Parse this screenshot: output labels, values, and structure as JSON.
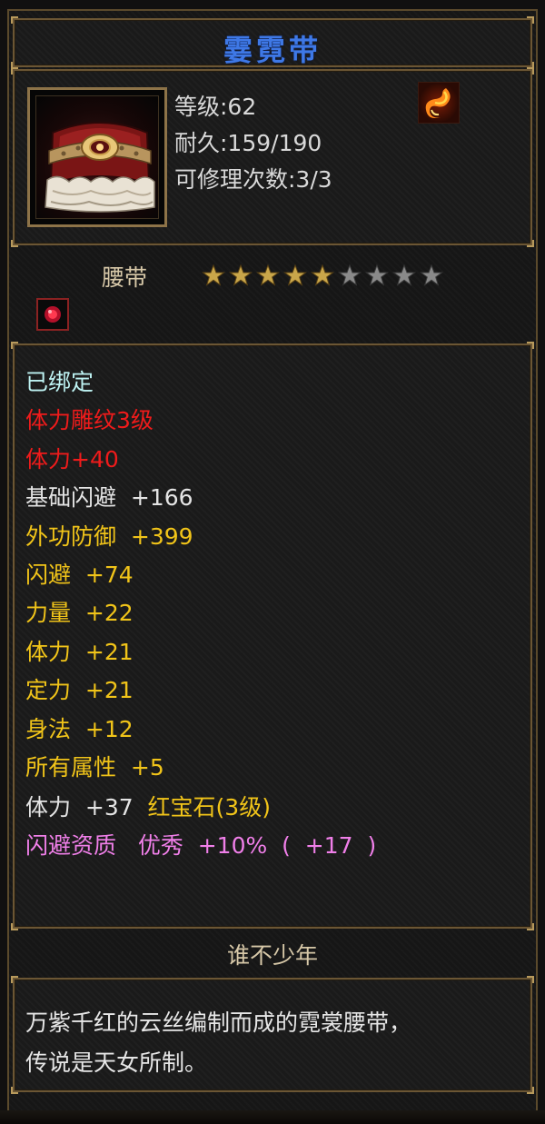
{
  "item": {
    "name": "霎霓带",
    "level_text": "等级:62",
    "durability_text": "耐久:159/190",
    "repair_text": "可修理次数:3/3",
    "type": "腰带",
    "stars": {
      "filled": 5,
      "total": 9
    }
  },
  "attributes": [
    {
      "text": "已绑定",
      "color": "cyan"
    },
    {
      "text": "体力雕纹3级",
      "color": "red"
    },
    {
      "text": "体力+40",
      "color": "red"
    },
    {
      "text": "基础闪避  +166",
      "color": "white"
    },
    {
      "text": "外功防御  +399",
      "color": "gold"
    },
    {
      "text": "闪避  +74",
      "color": "gold"
    },
    {
      "text": "力量  +22",
      "color": "gold"
    },
    {
      "text": "体力  +21",
      "color": "gold"
    },
    {
      "text": "定力  +21",
      "color": "gold"
    },
    {
      "text": "身法  +12",
      "color": "gold"
    },
    {
      "text": "所有属性  +5",
      "color": "gold"
    }
  ],
  "gem_line": {
    "stat": "体力  +37  ",
    "gem": "红宝石(3级)"
  },
  "aptitude_line": "闪避资质   优秀  +10%  (  +17  )",
  "footer_title": "谁不少年",
  "description": [
    "万紫千红的云丝编制而成的霓裳腰带，",
    "传说是天女所制。"
  ],
  "colors": {
    "title": "#3e78e6",
    "cyan": "#bdf2f2",
    "red": "#ef1b1b",
    "gold": "#f1c419",
    "pink": "#f07fe9",
    "star_filled": "#c9a64a",
    "star_empty": "#8a8a8a"
  },
  "icons": {
    "element": "fire-swirl-icon",
    "gem_socket": "red-gem-socket-icon",
    "item": "belt-item-icon"
  }
}
